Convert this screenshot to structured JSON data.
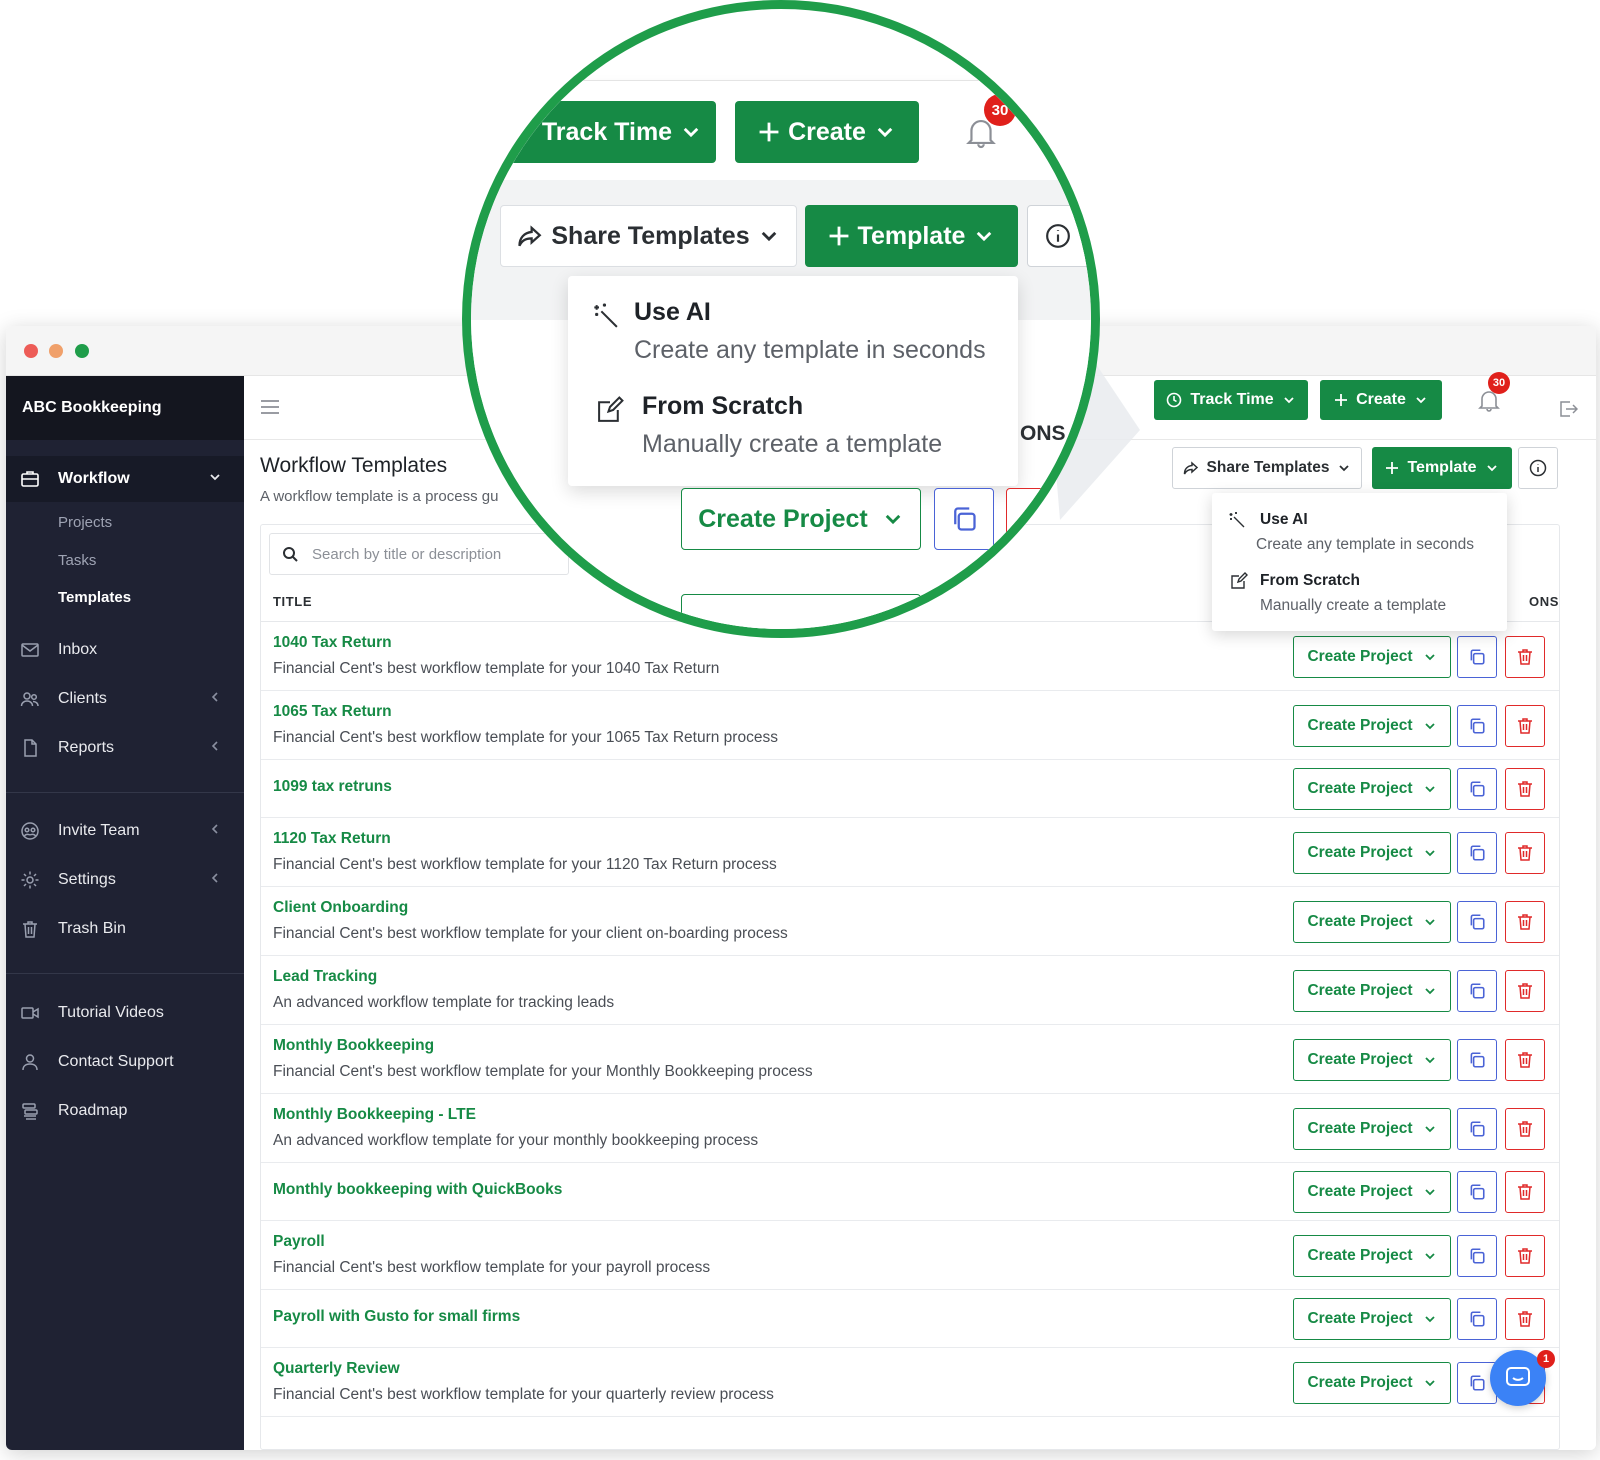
{
  "window": {
    "controls": [
      "close",
      "minimize",
      "maximize"
    ]
  },
  "sidebar": {
    "brand": "ABC Bookkeeping",
    "workflow": {
      "label": "Workflow",
      "icon": "briefcase-icon",
      "subitems": [
        "Projects",
        "Tasks",
        "Templates"
      ]
    },
    "items": [
      {
        "label": "Inbox",
        "icon": "mail-icon"
      },
      {
        "label": "Clients",
        "icon": "users-icon"
      },
      {
        "label": "Reports",
        "icon": "file-icon"
      },
      {
        "label": "Invite Team",
        "icon": "team-icon"
      },
      {
        "label": "Settings",
        "icon": "gear-icon"
      },
      {
        "label": "Trash Bin",
        "icon": "trash-icon"
      },
      {
        "label": "Tutorial Videos",
        "icon": "video-icon"
      },
      {
        "label": "Contact Support",
        "icon": "user-icon"
      },
      {
        "label": "Roadmap",
        "icon": "roadmap-icon"
      }
    ]
  },
  "topbar": {
    "track_time": "Track Time",
    "create": "Create",
    "notifications": "30"
  },
  "page": {
    "title": "Workflow Templates",
    "subtitle": "A workflow template is a process gu"
  },
  "toolbar": {
    "share_templates": "Share Templates",
    "template": "Template"
  },
  "template_menu": {
    "use_ai_title": "Use AI",
    "use_ai_sub": "Create any template in seconds",
    "scratch_title": "From Scratch",
    "scratch_sub": "Manually create a template"
  },
  "table": {
    "search_placeholder": "Search by title or description",
    "col_title": "TITLE",
    "col_actions_fragment": "ONS",
    "action_label": "Create Project",
    "rows": [
      {
        "title": "1040 Tax Return",
        "desc": "Financial Cent's best workflow template for your 1040 Tax Return"
      },
      {
        "title": "1065 Tax Return",
        "desc": "Financial Cent's best workflow template for your 1065 Tax Return process"
      },
      {
        "title": "1099 tax retruns",
        "desc": ""
      },
      {
        "title": "1120 Tax Return",
        "desc": "Financial Cent's best workflow template for your 1120 Tax Return process"
      },
      {
        "title": "Client Onboarding",
        "desc": "Financial Cent's best workflow template for your client on-boarding process"
      },
      {
        "title": "Lead Tracking",
        "desc": "An advanced workflow template for tracking leads"
      },
      {
        "title": "Monthly Bookkeeping",
        "desc": "Financial Cent's best workflow template for your Monthly Bookkeeping process"
      },
      {
        "title": "Monthly Bookkeeping - LTE",
        "desc": "An advanced workflow template for your monthly bookkeeping process"
      },
      {
        "title": "Monthly bookkeeping with QuickBooks",
        "desc": ""
      },
      {
        "title": "Payroll",
        "desc": "Financial Cent's best workflow template for your payroll process"
      },
      {
        "title": "Payroll with Gusto for small firms",
        "desc": ""
      },
      {
        "title": "Quarterly Review",
        "desc": "Financial Cent's best workflow template for your quarterly review process"
      }
    ]
  },
  "magnifier": {
    "track_time": "Track Time",
    "create": "Create",
    "badge": "30",
    "share_templates": "Share Templates",
    "template": "Template",
    "use_ai_title": "Use AI",
    "use_ai_sub": "Create any template in seconds",
    "scratch_title": "From Scratch",
    "scratch_sub": "Manually create a template",
    "create_project": "Create Project",
    "cut_label": "ONS"
  },
  "chat": {
    "badge": "1"
  },
  "colors": {
    "accent_green": "#168a45",
    "sidebar_bg": "#1f2233",
    "danger": "#e02a2a",
    "copy_blue": "#4a63d6",
    "magnifier_ring": "#1f9d4a"
  }
}
